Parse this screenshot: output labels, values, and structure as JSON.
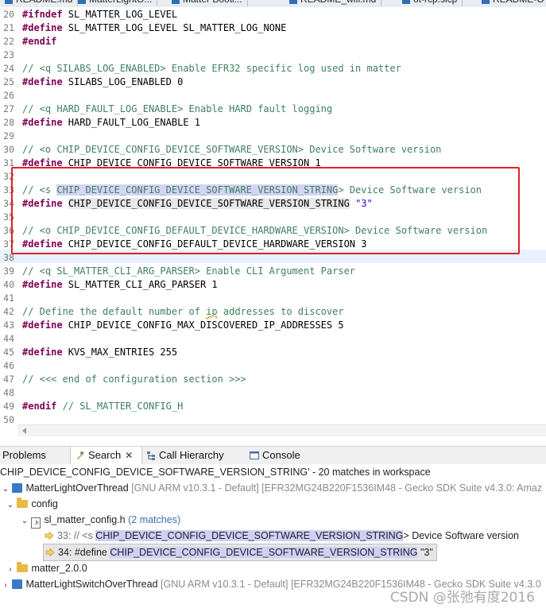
{
  "editor_tabs": [
    "README.md",
    "MatterLightO...",
    "Matter Bootl...",
    "README_wifi.md",
    "ot-rcp.slcp",
    "README-OT-R..."
  ],
  "code_lines": [
    {
      "n": "20",
      "parts": [
        [
          "kw",
          "#ifndef"
        ],
        [
          "txt",
          " SL_MATTER_LOG_LEVEL"
        ]
      ]
    },
    {
      "n": "21",
      "parts": [
        [
          "kw",
          "#define"
        ],
        [
          "txt",
          " SL_MATTER_LOG_LEVEL SL_MATTER_LOG_NONE"
        ]
      ]
    },
    {
      "n": "22",
      "parts": [
        [
          "kw",
          "#endif"
        ]
      ]
    },
    {
      "n": "23",
      "parts": []
    },
    {
      "n": "24",
      "parts": [
        [
          "cm",
          "// <q SILABS_LOG_ENABLED> Enable EFR32 specific log used in matter"
        ]
      ]
    },
    {
      "n": "25",
      "parts": [
        [
          "kw",
          "#define"
        ],
        [
          "txt",
          " SILABS_LOG_ENABLED 0"
        ]
      ]
    },
    {
      "n": "26",
      "parts": []
    },
    {
      "n": "27",
      "parts": [
        [
          "cm",
          "// <q HARD_FAULT_LOG_ENABLE> Enable HARD fault logging"
        ]
      ]
    },
    {
      "n": "28",
      "parts": [
        [
          "kw",
          "#define"
        ],
        [
          "txt",
          " HARD_FAULT_LOG_ENABLE 1"
        ]
      ]
    },
    {
      "n": "29",
      "parts": []
    },
    {
      "n": "30",
      "parts": [
        [
          "cm",
          "// <o CHIP_DEVICE_CONFIG_DEVICE_SOFTWARE_VERSION> Device Software version"
        ]
      ]
    },
    {
      "n": "31",
      "parts": [
        [
          "kw",
          "#define"
        ],
        [
          "txt",
          " CHIP_DEVICE_CONFIG_DEVICE_SOFTWARE_VERSION 1"
        ]
      ]
    },
    {
      "n": "32",
      "parts": []
    },
    {
      "n": "33",
      "parts": [
        [
          "cm",
          "// <s "
        ],
        [
          "cmhl",
          "CHIP_DEVICE_CONFIG_DEVICE_SOFTWARE_VERSION_STRING"
        ],
        [
          "cm",
          "> Device Software version"
        ]
      ]
    },
    {
      "n": "34",
      "parts": [
        [
          "kw",
          "#define"
        ],
        [
          "txt",
          " "
        ],
        [
          "txthl2",
          "CHIP_DEVICE_CONFIG_DEVICE_SOFTWARE_VERSION_STRING"
        ],
        [
          "txt",
          " "
        ],
        [
          "str",
          "\"3\""
        ]
      ]
    },
    {
      "n": "35",
      "parts": []
    },
    {
      "n": "36",
      "parts": [
        [
          "cm",
          "// <o CHIP_DEVICE_CONFIG_DEFAULT_DEVICE_HARDWARE_VERSION> Device Software version"
        ]
      ]
    },
    {
      "n": "37",
      "parts": [
        [
          "kw",
          "#define"
        ],
        [
          "txt",
          " CHIP_DEVICE_CONFIG_DEFAULT_DEVICE_HARDWARE_VERSION 3"
        ]
      ]
    },
    {
      "n": "38",
      "parts": []
    },
    {
      "n": "39",
      "parts": [
        [
          "cm",
          "// <q SL_MATTER_CLI_ARG_PARSER> Enable CLI Argument Parser"
        ]
      ]
    },
    {
      "n": "40",
      "parts": [
        [
          "kw",
          "#define"
        ],
        [
          "txt",
          " SL_MATTER_CLI_ARG_PARSER 1"
        ]
      ]
    },
    {
      "n": "41",
      "parts": []
    },
    {
      "n": "42",
      "parts": [
        [
          "cm",
          "// Define the default number of "
        ],
        [
          "cmsq",
          "ip"
        ],
        [
          "cm",
          " addresses to discover"
        ]
      ]
    },
    {
      "n": "43",
      "parts": [
        [
          "kw",
          "#define"
        ],
        [
          "txt",
          " CHIP_DEVICE_CONFIG_MAX_DISCOVERED_IP_ADDRESSES 5"
        ]
      ]
    },
    {
      "n": "44",
      "parts": []
    },
    {
      "n": "45",
      "parts": [
        [
          "kw",
          "#define"
        ],
        [
          "txt",
          " KVS_MAX_ENTRIES 255"
        ]
      ]
    },
    {
      "n": "46",
      "parts": []
    },
    {
      "n": "47",
      "parts": [
        [
          "cm",
          "// <<< end of configuration section >>>"
        ]
      ]
    },
    {
      "n": "48",
      "parts": []
    },
    {
      "n": "49",
      "parts": [
        [
          "kw",
          "#endif"
        ],
        [
          "cm",
          " // SL_MATTER_CONFIG_H"
        ]
      ]
    },
    {
      "n": "50",
      "parts": []
    }
  ],
  "views": {
    "problems": "Problems",
    "search": "Search",
    "call_hierarchy": "Call Hierarchy",
    "console": "Console"
  },
  "search": {
    "summary": "CHIP_DEVICE_CONFIG_DEVICE_SOFTWARE_VERSION_STRING' - 20 matches in workspace",
    "project1_name": "MatterLightOverThread",
    "project1_meta": "[GNU ARM v10.3.1 - Default] [EFR32MG24B220F1536IM48 - Gecko SDK Suite v4.3.0: Amaz",
    "folder_config": "config",
    "file_name": "sl_matter_config.h",
    "file_matches": "(2 matches)",
    "match1_prefix": "33: // <s ",
    "match1_term": "CHIP_DEVICE_CONFIG_DEVICE_SOFTWARE_VERSION_STRING",
    "match1_suffix": "> Device Software version",
    "match2_prefix": "34: #define ",
    "match2_term": "CHIP_DEVICE_CONFIG_DEVICE_SOFTWARE_VERSION_STRING",
    "match2_suffix": " \"3\"",
    "folder_matter": "matter_2.0.0",
    "project2_name": "MatterLightSwitchOverThread",
    "project2_meta": "[GNU ARM v10.3.1 - Default] [EFR32MG24B220F1536IM48 - Gecko SDK Suite v4.3.0"
  },
  "watermark": "CSDN @张弛有度2016",
  "colors": {
    "keyword": "#7f0055",
    "comment": "#3f7f5f",
    "string": "#2a00ff",
    "highlight_box": "#e0202a"
  }
}
